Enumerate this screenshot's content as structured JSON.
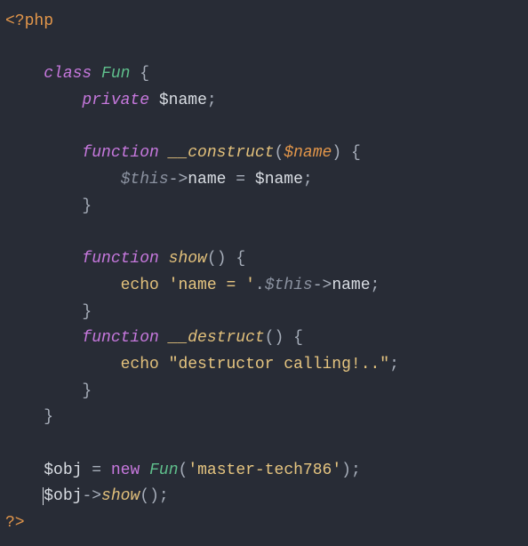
{
  "open_tag": "<?php",
  "close_tag": "?>",
  "kw_class": "class",
  "cls_name": "Fun",
  "brace_open": "{",
  "brace_close": "}",
  "kw_private": "private",
  "var_name": "$name",
  "semi": ";",
  "kw_function": "function",
  "fn_construct": "__construct",
  "paren_open": "(",
  "paren_close": ")",
  "var_this": "$this",
  "arrow": "->",
  "prop_name": "name",
  "assign": "=",
  "fn_show": "show",
  "kw_echo": "echo",
  "str_name_eq": "'name = '",
  "dot": ".",
  "fn_destruct": "__destruct",
  "str_destruct": "\"destructor calling!..\"",
  "var_obj": "$obj",
  "kw_new": "new",
  "str_master": "'master-tech786'"
}
